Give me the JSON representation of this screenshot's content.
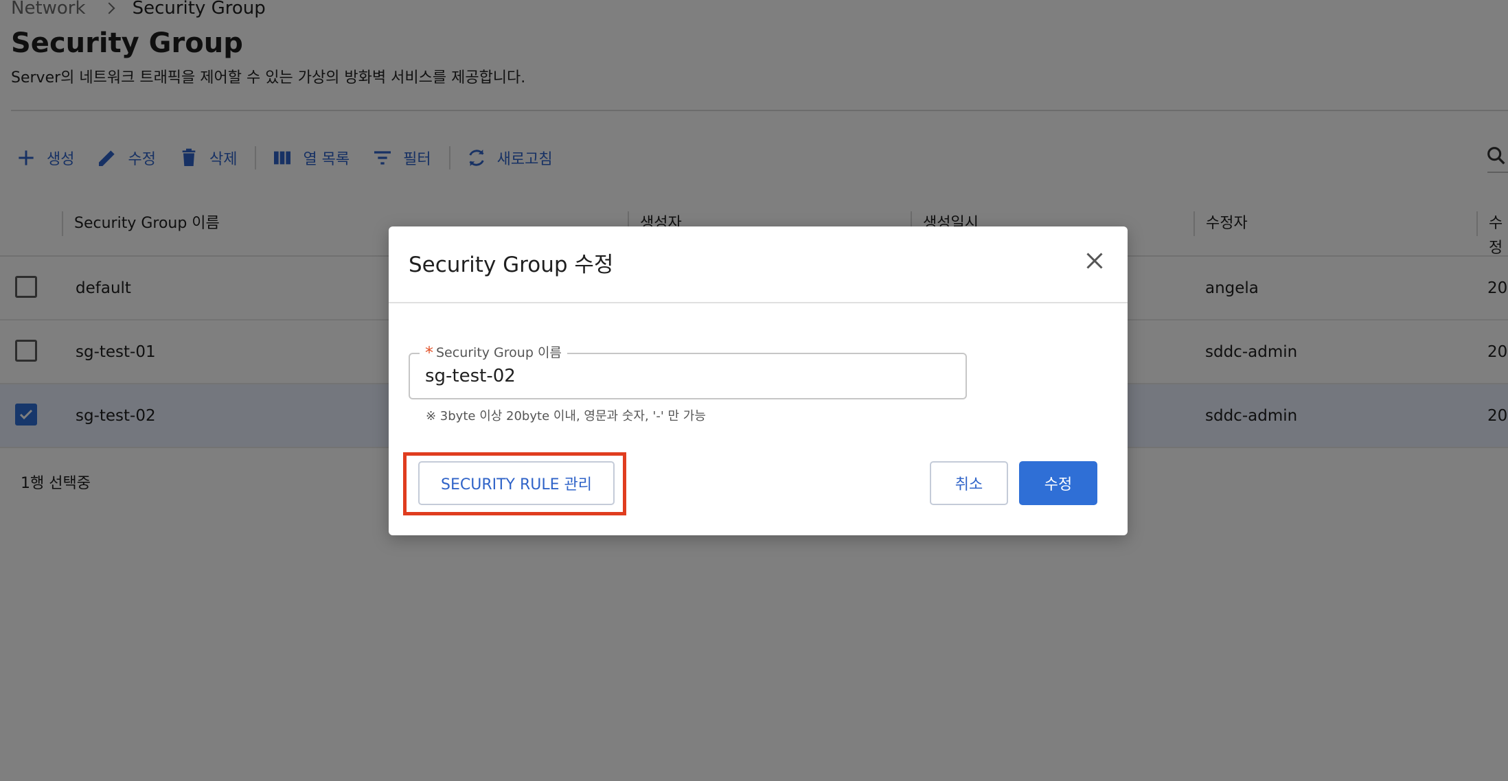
{
  "breadcrumb": {
    "parent": "Network",
    "current": "Security Group"
  },
  "page": {
    "title": "Security Group",
    "description": "Server의 네트워크 트래픽을 제어할 수 있는 가상의 방화벽 서비스를 제공합니다."
  },
  "toolbar": {
    "create": "생성",
    "edit": "수정",
    "delete": "삭제",
    "columns": "열 목록",
    "filter": "필터",
    "refresh": "새로고침"
  },
  "table": {
    "headers": [
      "Security Group 이름",
      "생성자",
      "생성일시",
      "수정자",
      "수정"
    ],
    "rows": [
      {
        "name": "default",
        "modifier": "angela",
        "modified_at": "20",
        "checked": false
      },
      {
        "name": "sg-test-01",
        "modifier": "sddc-admin",
        "modified_at": "20",
        "checked": false
      },
      {
        "name": "sg-test-02",
        "modifier": "sddc-admin",
        "modified_at": "20",
        "checked": true
      }
    ],
    "selection_status": "1행 선택중"
  },
  "modal": {
    "title": "Security Group 수정",
    "field_label": "Security Group 이름",
    "field_required_mark": "*",
    "field_value": "sg-test-02",
    "field_hint": "※ 3byte 이상 20byte 이내, 영문과 숫자, '-' 만 가능",
    "rule_button": "SECURITY RULE 관리",
    "cancel_button": "취소",
    "submit_button": "수정"
  },
  "colors": {
    "accent": "#2f6fd6",
    "highlight": "#e03d1f",
    "required": "#e2542b"
  }
}
